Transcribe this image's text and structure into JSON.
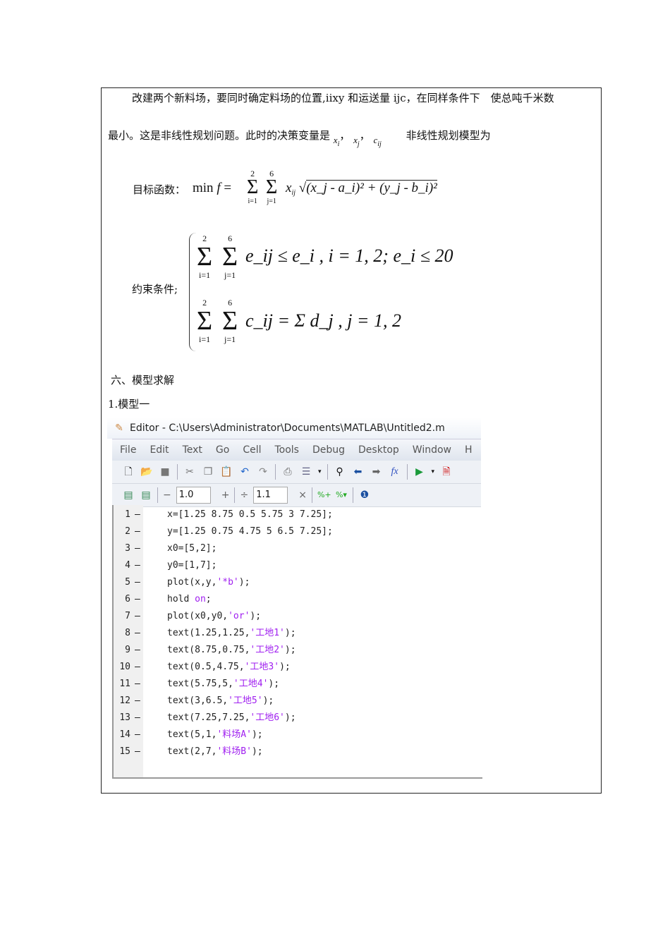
{
  "para1": "改建两个新料场，要同时确定料场的位置,iixy 和运送量 ijc，在同样条件下　使总吨千米数",
  "para2": "最小。这是非线性规划问题。此时的决策变量是",
  "vars": [
    "x",
    "i",
    "x",
    "j",
    "c",
    "ij"
  ],
  "para2_end": "非线性规划模型为",
  "objective": {
    "label": "目标函数：",
    "min": "min",
    "f": "f",
    "eq": "=",
    "top1": "2",
    "bot1": "i=1",
    "top2": "6",
    "bot2": "j=1",
    "body": "x",
    "body_sub": "ij",
    "rad": "(x_j - a_i)² + (y_j - b_i)²"
  },
  "constraint": {
    "label": "约束条件;",
    "c1": "e_ij ≤ e_i , i = 1, 2; e_i ≤ 20",
    "c2": "c_ij = Σ d_j , j = 1, 2",
    "top_i": "2",
    "top_j": "6",
    "bot_i": "i=1",
    "bot_j": "j=1"
  },
  "section": "六、模型求解",
  "subsection": "1.模型一",
  "editor": {
    "title": "Editor - C:\\Users\\Administrator\\Documents\\MATLAB\\Untitled2.m",
    "menu": [
      "File",
      "Edit",
      "Text",
      "Go",
      "Cell",
      "Tools",
      "Debug",
      "Desktop",
      "Window",
      "H"
    ],
    "cell_minus": "−",
    "cell_val1": "1.0",
    "cell_plus": "+",
    "cell_div": "÷",
    "cell_val2": "1.1",
    "cell_x": "×",
    "lines": [
      [
        [
          "x=[1.25 8.75 0.5 5.75 3 7.25];",
          "#222"
        ]
      ],
      [
        [
          "y=[1.25 0.75 4.75 5 6.5 7.25];",
          "#222"
        ]
      ],
      [
        [
          "x0=[5,2];",
          "#222"
        ]
      ],
      [
        [
          "y0=[1,7];",
          "#222"
        ]
      ],
      [
        [
          "plot(x,y,",
          "#222"
        ],
        [
          "'*b'",
          "#a020f0"
        ],
        [
          ");",
          "#222"
        ]
      ],
      [
        [
          "hold ",
          "#222"
        ],
        [
          "on",
          "#a020f0"
        ],
        [
          ";",
          "#222"
        ]
      ],
      [
        [
          "plot(x0,y0,",
          "#222"
        ],
        [
          "'or'",
          "#a020f0"
        ],
        [
          ");",
          "#222"
        ]
      ],
      [
        [
          "text(1.25,1.25,",
          "#222"
        ],
        [
          "'工地1'",
          "#a020f0"
        ],
        [
          ");",
          "#222"
        ]
      ],
      [
        [
          "text(8.75,0.75,",
          "#222"
        ],
        [
          "'工地2'",
          "#a020f0"
        ],
        [
          ");",
          "#222"
        ]
      ],
      [
        [
          "text(0.5,4.75,",
          "#222"
        ],
        [
          "'工地3'",
          "#a020f0"
        ],
        [
          ");",
          "#222"
        ]
      ],
      [
        [
          "text(5.75,5,",
          "#222"
        ],
        [
          "'工地4'",
          "#a020f0"
        ],
        [
          ");",
          "#222"
        ]
      ],
      [
        [
          "text(3,6.5,",
          "#222"
        ],
        [
          "'工地5'",
          "#a020f0"
        ],
        [
          ");",
          "#222"
        ]
      ],
      [
        [
          "text(7.25,7.25,",
          "#222"
        ],
        [
          "'工地6'",
          "#a020f0"
        ],
        [
          ");",
          "#222"
        ]
      ],
      [
        [
          "text(5,1,",
          "#222"
        ],
        [
          "'料场A'",
          "#a020f0"
        ],
        [
          ");",
          "#222"
        ]
      ],
      [
        [
          "text(2,7,",
          "#222"
        ],
        [
          "'料场B'",
          "#a020f0"
        ],
        [
          ");",
          "#222"
        ]
      ]
    ]
  }
}
